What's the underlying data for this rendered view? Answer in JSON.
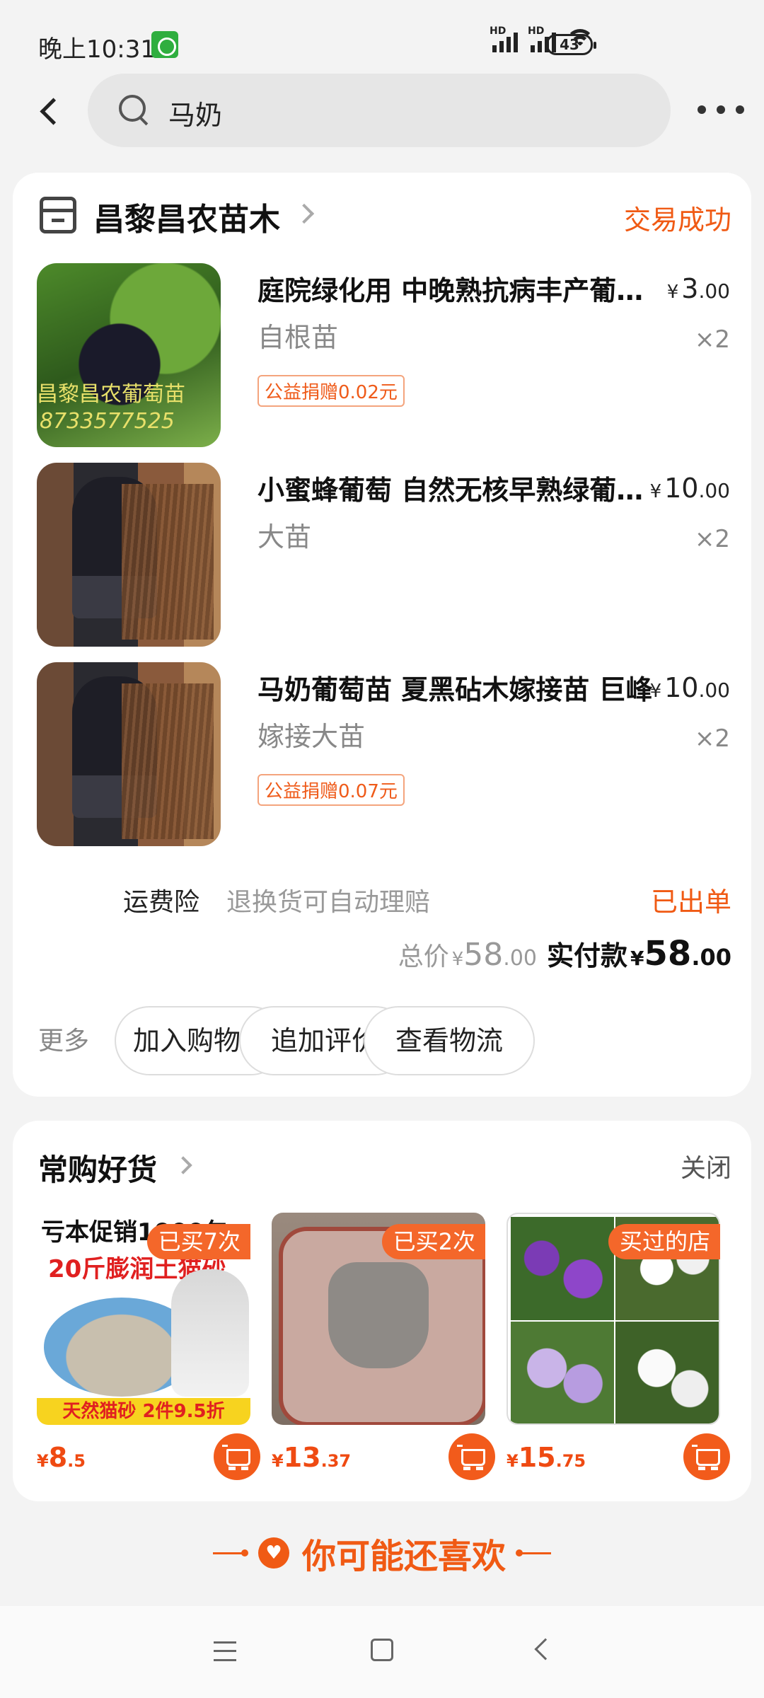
{
  "status_bar": {
    "time": "晚上10:31",
    "battery": "43",
    "signal_label": "HD"
  },
  "search": {
    "query": "马奶"
  },
  "order": {
    "shop_name": "昌黎昌农苗木",
    "status": "交易成功",
    "products": [
      {
        "title": "庭院绿化用 中晚熟抗病丰产葡萄苗",
        "spec": "自根苗",
        "currency": "¥",
        "price_int": "3",
        "price_dec": ".00",
        "qty": "×2",
        "donation": "公益捐赠0.02元",
        "image_watermark_1": "昌黎昌农葡萄苗",
        "image_watermark_2": "8733577525"
      },
      {
        "title": "小蜜蜂葡萄 自然无核早熟绿葡萄苗",
        "spec": "大苗",
        "currency": "¥",
        "price_int": "10",
        "price_dec": ".00",
        "qty": "×2",
        "donation": ""
      },
      {
        "title": "马奶葡萄苗 夏黑砧木嫁接苗 巨峰",
        "spec": "嫁接大苗",
        "currency": "¥",
        "price_int": "10",
        "price_dec": ".00",
        "qty": "×2",
        "donation": "公益捐赠0.07元"
      }
    ],
    "insurance_label": "运费险",
    "insurance_desc": "退换货可自动理赔",
    "insurance_status": "已出单",
    "total_label": "总价",
    "total_currency": "¥",
    "total_int": "58",
    "total_dec": ".00",
    "paid_label": "实付款",
    "paid_currency": "¥",
    "paid_int": "58",
    "paid_dec": ".00",
    "more_label": "更多",
    "actions": [
      "加入购物车",
      "追加评价",
      "查看物流"
    ]
  },
  "frequent": {
    "title": "常购好货",
    "close_label": "关闭",
    "items": [
      {
        "badge": "已买7次",
        "currency": "¥",
        "price_int": "8",
        "price_dec": ".5",
        "img_top": "亏本促销1000包",
        "img_mid": "20斤膨润土猫砂",
        "img_bottom": "天然猫砂 2件9.5折"
      },
      {
        "badge": "已买2次",
        "currency": "¥",
        "price_int": "13",
        "price_dec": ".37"
      },
      {
        "badge": "买过的店",
        "currency": "¥",
        "price_int": "15",
        "price_dec": ".75"
      }
    ]
  },
  "recommend": {
    "text": "你可能还喜欢"
  },
  "colors": {
    "accent": "#f05a14",
    "background": "#f3f3f3",
    "card": "#ffffff"
  },
  "icons": [
    "back-arrow-icon",
    "search-icon",
    "more-dots-icon",
    "shop-icon",
    "chevron-right-icon",
    "cart-icon",
    "heart-icon",
    "menu-icon",
    "home-icon",
    "nav-back-icon"
  ]
}
